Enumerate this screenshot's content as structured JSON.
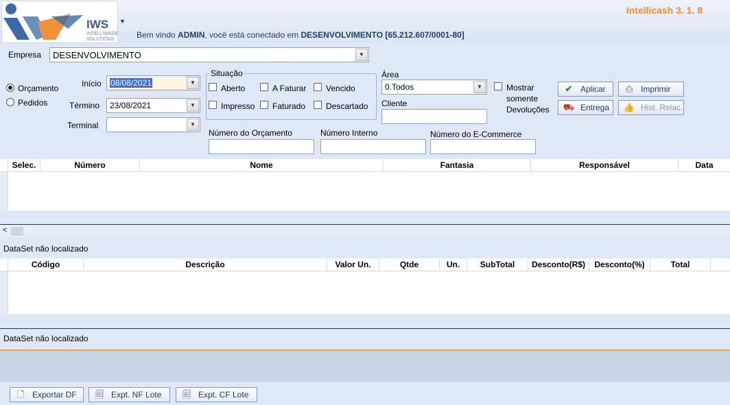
{
  "header": {
    "logo_text": "IWS",
    "logo_sub": "INTELLIWARE SOLUTIONS",
    "welcome_prefix": "Bem vindo",
    "user": "ADMIN",
    "welcome_mid": ", você está conectado em",
    "connection": "DESENVOLVIMENTO [65.212.607/0001-80]",
    "app_title": "Intellicash 3. 1.  8"
  },
  "filters": {
    "empresa_label": "Empresa",
    "empresa_value": "DESENVOLVIMENTO",
    "radio_orcamento": "Orçamento",
    "radio_pedidos": "Pedidos",
    "radio_selected": "orcamento",
    "inicio_label": "Início",
    "inicio_value": "08/08/2021",
    "termino_label": "Término",
    "termino_value": "23/08/2021",
    "terminal_label": "Terminal",
    "terminal_value": "",
    "situacao_title": "Situação",
    "situacao": {
      "aberto": "Aberto",
      "a_faturar": "A Faturar",
      "vencido": "Vencido",
      "impresso": "Impresso",
      "faturado": "Faturado",
      "descartado": "Descartado"
    },
    "area_label": "Área",
    "area_value": "0.Todos",
    "cliente_label": "Cliente",
    "cliente_value": "",
    "mostrar_label_1": "Mostrar",
    "mostrar_label_2": "somente",
    "mostrar_label_3": "Devoluções",
    "num_orcamento_label": "Número do Orçamento",
    "num_interno_label": "Número Interno",
    "num_ecommerce_label": "Número do E-Commerce"
  },
  "buttons": {
    "aplicar": "Aplicar",
    "imprimir": "Imprimir",
    "entrega": "Entrega",
    "hist_relac": "Hist. Relac."
  },
  "grid1": {
    "columns": [
      "Selec.",
      "Número",
      "Nome",
      "Fantasia",
      "Responsável",
      "Data"
    ],
    "status": "DataSet não localizado"
  },
  "grid2": {
    "columns": [
      "Código",
      "Descrição",
      "Valor Un.",
      "Qtde",
      "Un.",
      "SubTotal",
      "Desconto(R$)",
      "Desconto(%)",
      "Total"
    ],
    "status": "DataSet não localizado"
  },
  "footer": {
    "exportar_df": "Exportar DF",
    "expt_nf_lote": "Expt. NF Lote",
    "expt_cf_lote": "Expt. CF Lote"
  },
  "colors": {
    "title": "#ff8a1a",
    "background": "#dfe8f6",
    "accent": "#f2a33a"
  }
}
